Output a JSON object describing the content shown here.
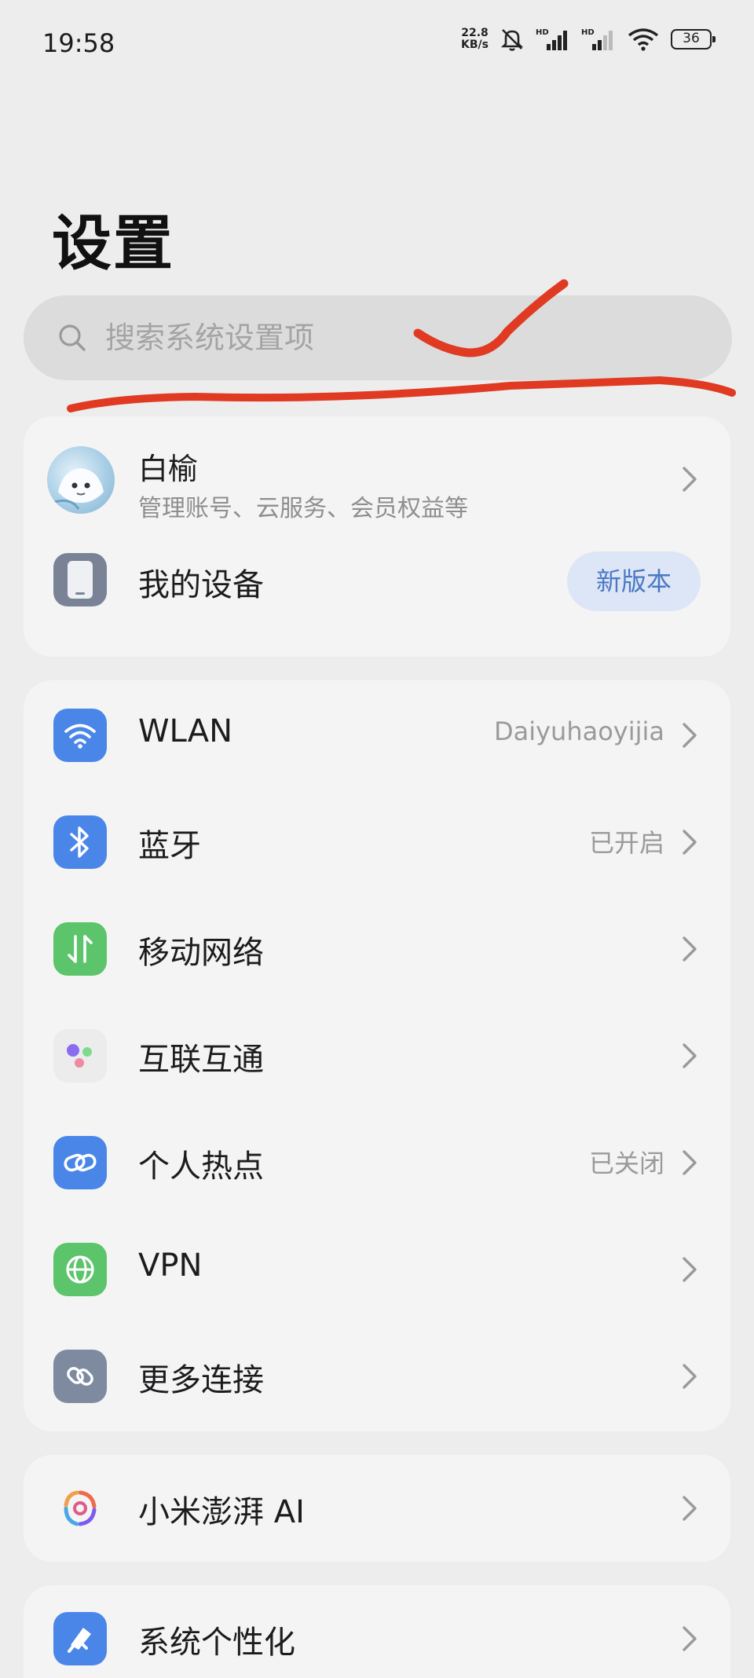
{
  "status_bar": {
    "time": "19:58",
    "net_speed_value": "22.8",
    "net_speed_unit": "KB/s",
    "battery": "36",
    "icons": [
      "mute-bell-icon",
      "hd-signal-icon",
      "hd-signal-icon",
      "wifi-icon",
      "battery-icon"
    ]
  },
  "header": {
    "title": "设置"
  },
  "search": {
    "placeholder": "搜索系统设置项",
    "icon": "search-icon"
  },
  "account": {
    "name": "白榆",
    "subtitle": "管理账号、云服务、会员权益等",
    "device_label": "我的设备",
    "device_badge": "新版本",
    "device_icon": "phone-icon"
  },
  "connections": [
    {
      "label": "WLAN",
      "value": "Daiyuhaoyijia",
      "icon": "wifi-icon",
      "color": "#4a86e8"
    },
    {
      "label": "蓝牙",
      "value": "已开启",
      "icon": "bluetooth-icon",
      "color": "#4a86e8"
    },
    {
      "label": "移动网络",
      "value": "",
      "icon": "mobile-data-icon",
      "color": "#5cc46a"
    },
    {
      "label": "互联互通",
      "value": "",
      "icon": "interconnect-icon",
      "color": "#f0f0f0"
    },
    {
      "label": "个人热点",
      "value": "已关闭",
      "icon": "hotspot-icon",
      "color": "#4a86e8"
    },
    {
      "label": "VPN",
      "value": "",
      "icon": "globe-icon",
      "color": "#5cc46a"
    },
    {
      "label": "更多连接",
      "value": "",
      "icon": "link-icon",
      "color": "#7d8aa0"
    }
  ],
  "ai": {
    "label": "小米澎湃 AI",
    "icon": "hyperai-icon"
  },
  "personalize": {
    "label": "系统个性化",
    "icon": "brush-icon",
    "color": "#4a86e8"
  },
  "annotation_color": "#e03a22"
}
